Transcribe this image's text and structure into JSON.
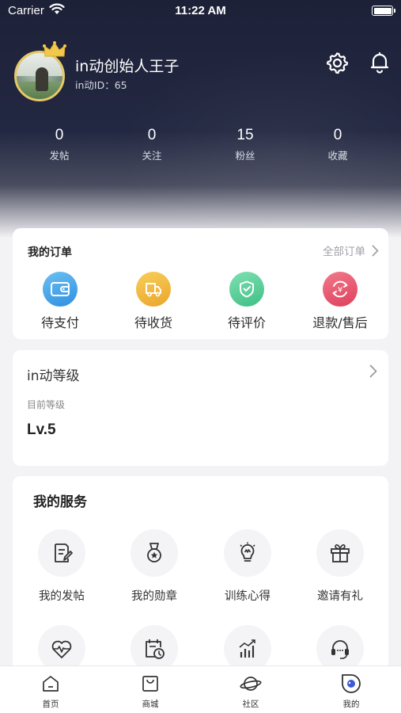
{
  "status_bar": {
    "carrier": "Carrier",
    "time": "11:22 AM"
  },
  "profile": {
    "name": "in动创始人王子",
    "id_label": "in动ID：65"
  },
  "stats": [
    {
      "value": "0",
      "label": "发帖"
    },
    {
      "value": "0",
      "label": "关注"
    },
    {
      "value": "15",
      "label": "粉丝"
    },
    {
      "value": "0",
      "label": "收藏"
    }
  ],
  "orders": {
    "title": "我的订单",
    "all_link": "全部订单",
    "items": [
      {
        "label": "待支付",
        "icon": "wallet-icon",
        "color": "#3a9fe6"
      },
      {
        "label": "待收货",
        "icon": "truck-icon",
        "color": "#f0b53a"
      },
      {
        "label": "待评价",
        "icon": "shield-icon",
        "color": "#5ccf9a"
      },
      {
        "label": "退款/售后",
        "icon": "refund-icon",
        "color": "#e8546a"
      }
    ]
  },
  "level": {
    "title": "in动等级",
    "subtitle": "目前等级",
    "value": "Lv.5"
  },
  "services": {
    "title": "我的服务",
    "items": [
      {
        "label": "我的发帖",
        "icon": "edit-note-icon"
      },
      {
        "label": "我的勋章",
        "icon": "medal-icon"
      },
      {
        "label": "训练心得",
        "icon": "lightbulb-icon"
      },
      {
        "label": "邀请有礼",
        "icon": "gift-icon"
      },
      {
        "label": "",
        "icon": "heart-rate-icon"
      },
      {
        "label": "",
        "icon": "calendar-clock-icon"
      },
      {
        "label": "",
        "icon": "bar-chart-icon"
      },
      {
        "label": "",
        "icon": "headset-icon"
      }
    ]
  },
  "tabbar": [
    {
      "label": "首页",
      "icon": "home-icon"
    },
    {
      "label": "商城",
      "icon": "shop-bag-icon"
    },
    {
      "label": "社区",
      "icon": "planet-icon"
    },
    {
      "label": "我的",
      "icon": "profile-icon"
    }
  ]
}
